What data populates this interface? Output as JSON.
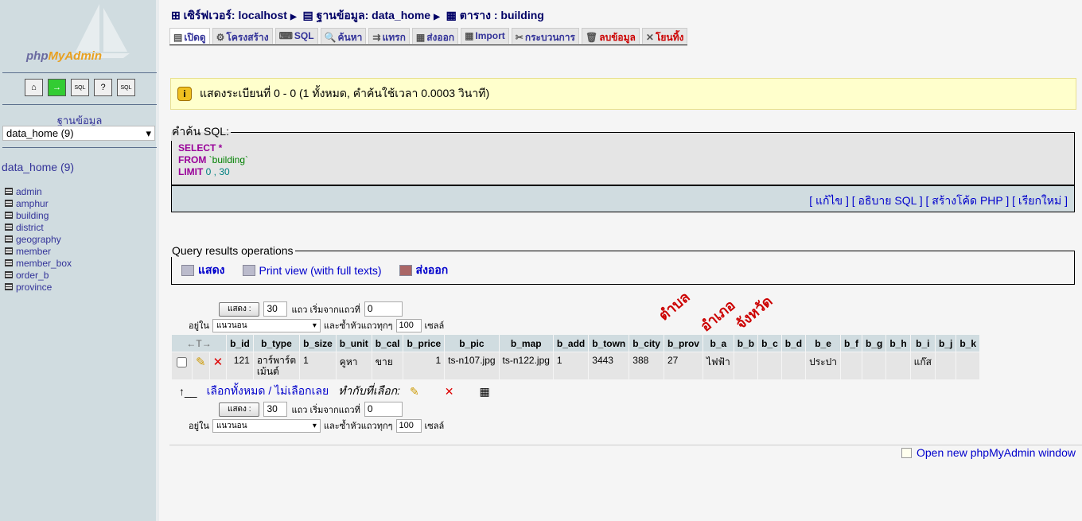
{
  "sidebar": {
    "logo": "phpMyAdmin",
    "logo_a": "php",
    "logo_b": "MyAdmin",
    "db_label": "ฐานข้อมูล",
    "db_selected": "data_home (9)",
    "db_title": "data_home (9)",
    "tables": [
      "admin",
      "amphur",
      "building",
      "district",
      "geography",
      "member",
      "member_box",
      "order_b",
      "province"
    ]
  },
  "breadcrumb": {
    "server": "เซิร์ฟเวอร์: localhost",
    "database": "ฐานข้อมูล: data_home",
    "table": "ตาราง : building"
  },
  "tabs": [
    "เปิดดู",
    "โครงสร้าง",
    "SQL",
    "ค้นหา",
    "แทรก",
    "ส่งออก",
    "Import",
    "กระบวนการ",
    "ลบข้อมูล",
    "โยนทิ้ง"
  ],
  "notice": "แสดงระเบียนที่ 0 - 0 (1 ทั้งหมด, คำค้นใช้เวลา 0.0003 วินาที)",
  "sql": {
    "legend": "คำค้น SQL:",
    "kw1": "SELECT",
    "star": " *",
    "kw2": "FROM",
    "table": " `building`",
    "kw3": "LIMIT",
    "limit": " 0 , 30",
    "links": [
      "[ แก้ไข ]",
      "[ อธิบาย SQL ]",
      "[ สร้างโค้ด PHP ]",
      "[ เรียกใหม่ ]"
    ]
  },
  "qro": {
    "legend": "Query results operations",
    "print": "แสดง",
    "print_full": "Print view (with full texts)",
    "export": "ส่งออก"
  },
  "nav": {
    "show_button": "แสดง :",
    "rows": "30",
    "rows_label": "แถว เริ่มจากแถวที่",
    "start": "0",
    "in_label": "อยู่ใน",
    "mode": "แนวนอน",
    "repeat_label": "และซ้ำหัวแถวทุกๆ",
    "repeat": "100",
    "cells_label": "เซลล์"
  },
  "annotations": [
    "ตำบล",
    "อำเภอ",
    "จังหวัด"
  ],
  "table": {
    "sort_arrows": "←T→",
    "columns": [
      "b_id",
      "b_type",
      "b_size",
      "b_unit",
      "b_cal",
      "b_price",
      "b_pic",
      "b_map",
      "b_add",
      "b_town",
      "b_city",
      "b_prov",
      "b_a",
      "b_b",
      "b_c",
      "b_d",
      "b_e",
      "b_f",
      "b_g",
      "b_h",
      "b_i",
      "b_j",
      "b_k"
    ],
    "rows": [
      [
        "121",
        "อาร์พาร์ต\nเม้นต์",
        "1",
        "คูหา",
        "ขาย",
        "1",
        "ts-n107.jpg",
        "ts-n122.jpg",
        "1",
        "3443",
        "388",
        "27",
        "ไฟฟ้า",
        "",
        "",
        "",
        "ประปา",
        "",
        "",
        "",
        "แก๊ส",
        "",
        ""
      ]
    ]
  },
  "bulk": {
    "select_all": "เลือกทั้งหมด / ไม่เลือกเลย",
    "with_selected": "ทำกับที่เลือก:"
  },
  "footer": {
    "new_window": "Open new phpMyAdmin window"
  }
}
